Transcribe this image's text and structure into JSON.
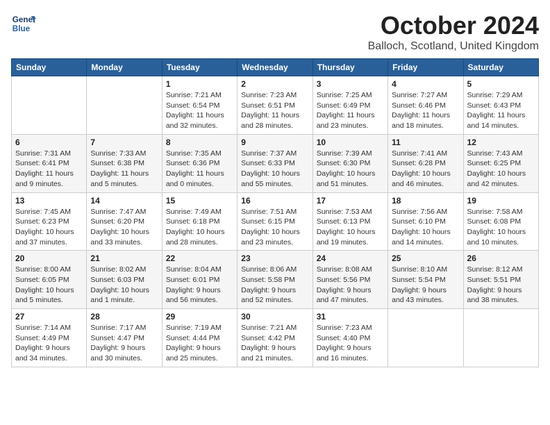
{
  "header": {
    "logo_line1": "General",
    "logo_line2": "Blue",
    "month_title": "October 2024",
    "location": "Balloch, Scotland, United Kingdom"
  },
  "days_of_week": [
    "Sunday",
    "Monday",
    "Tuesday",
    "Wednesday",
    "Thursday",
    "Friday",
    "Saturday"
  ],
  "weeks": [
    [
      {
        "day": "",
        "sunrise": "",
        "sunset": "",
        "daylight": ""
      },
      {
        "day": "",
        "sunrise": "",
        "sunset": "",
        "daylight": ""
      },
      {
        "day": "1",
        "sunrise": "Sunrise: 7:21 AM",
        "sunset": "Sunset: 6:54 PM",
        "daylight": "Daylight: 11 hours and 32 minutes."
      },
      {
        "day": "2",
        "sunrise": "Sunrise: 7:23 AM",
        "sunset": "Sunset: 6:51 PM",
        "daylight": "Daylight: 11 hours and 28 minutes."
      },
      {
        "day": "3",
        "sunrise": "Sunrise: 7:25 AM",
        "sunset": "Sunset: 6:49 PM",
        "daylight": "Daylight: 11 hours and 23 minutes."
      },
      {
        "day": "4",
        "sunrise": "Sunrise: 7:27 AM",
        "sunset": "Sunset: 6:46 PM",
        "daylight": "Daylight: 11 hours and 18 minutes."
      },
      {
        "day": "5",
        "sunrise": "Sunrise: 7:29 AM",
        "sunset": "Sunset: 6:43 PM",
        "daylight": "Daylight: 11 hours and 14 minutes."
      }
    ],
    [
      {
        "day": "6",
        "sunrise": "Sunrise: 7:31 AM",
        "sunset": "Sunset: 6:41 PM",
        "daylight": "Daylight: 11 hours and 9 minutes."
      },
      {
        "day": "7",
        "sunrise": "Sunrise: 7:33 AM",
        "sunset": "Sunset: 6:38 PM",
        "daylight": "Daylight: 11 hours and 5 minutes."
      },
      {
        "day": "8",
        "sunrise": "Sunrise: 7:35 AM",
        "sunset": "Sunset: 6:36 PM",
        "daylight": "Daylight: 11 hours and 0 minutes."
      },
      {
        "day": "9",
        "sunrise": "Sunrise: 7:37 AM",
        "sunset": "Sunset: 6:33 PM",
        "daylight": "Daylight: 10 hours and 55 minutes."
      },
      {
        "day": "10",
        "sunrise": "Sunrise: 7:39 AM",
        "sunset": "Sunset: 6:30 PM",
        "daylight": "Daylight: 10 hours and 51 minutes."
      },
      {
        "day": "11",
        "sunrise": "Sunrise: 7:41 AM",
        "sunset": "Sunset: 6:28 PM",
        "daylight": "Daylight: 10 hours and 46 minutes."
      },
      {
        "day": "12",
        "sunrise": "Sunrise: 7:43 AM",
        "sunset": "Sunset: 6:25 PM",
        "daylight": "Daylight: 10 hours and 42 minutes."
      }
    ],
    [
      {
        "day": "13",
        "sunrise": "Sunrise: 7:45 AM",
        "sunset": "Sunset: 6:23 PM",
        "daylight": "Daylight: 10 hours and 37 minutes."
      },
      {
        "day": "14",
        "sunrise": "Sunrise: 7:47 AM",
        "sunset": "Sunset: 6:20 PM",
        "daylight": "Daylight: 10 hours and 33 minutes."
      },
      {
        "day": "15",
        "sunrise": "Sunrise: 7:49 AM",
        "sunset": "Sunset: 6:18 PM",
        "daylight": "Daylight: 10 hours and 28 minutes."
      },
      {
        "day": "16",
        "sunrise": "Sunrise: 7:51 AM",
        "sunset": "Sunset: 6:15 PM",
        "daylight": "Daylight: 10 hours and 23 minutes."
      },
      {
        "day": "17",
        "sunrise": "Sunrise: 7:53 AM",
        "sunset": "Sunset: 6:13 PM",
        "daylight": "Daylight: 10 hours and 19 minutes."
      },
      {
        "day": "18",
        "sunrise": "Sunrise: 7:56 AM",
        "sunset": "Sunset: 6:10 PM",
        "daylight": "Daylight: 10 hours and 14 minutes."
      },
      {
        "day": "19",
        "sunrise": "Sunrise: 7:58 AM",
        "sunset": "Sunset: 6:08 PM",
        "daylight": "Daylight: 10 hours and 10 minutes."
      }
    ],
    [
      {
        "day": "20",
        "sunrise": "Sunrise: 8:00 AM",
        "sunset": "Sunset: 6:05 PM",
        "daylight": "Daylight: 10 hours and 5 minutes."
      },
      {
        "day": "21",
        "sunrise": "Sunrise: 8:02 AM",
        "sunset": "Sunset: 6:03 PM",
        "daylight": "Daylight: 10 hours and 1 minute."
      },
      {
        "day": "22",
        "sunrise": "Sunrise: 8:04 AM",
        "sunset": "Sunset: 6:01 PM",
        "daylight": "Daylight: 9 hours and 56 minutes."
      },
      {
        "day": "23",
        "sunrise": "Sunrise: 8:06 AM",
        "sunset": "Sunset: 5:58 PM",
        "daylight": "Daylight: 9 hours and 52 minutes."
      },
      {
        "day": "24",
        "sunrise": "Sunrise: 8:08 AM",
        "sunset": "Sunset: 5:56 PM",
        "daylight": "Daylight: 9 hours and 47 minutes."
      },
      {
        "day": "25",
        "sunrise": "Sunrise: 8:10 AM",
        "sunset": "Sunset: 5:54 PM",
        "daylight": "Daylight: 9 hours and 43 minutes."
      },
      {
        "day": "26",
        "sunrise": "Sunrise: 8:12 AM",
        "sunset": "Sunset: 5:51 PM",
        "daylight": "Daylight: 9 hours and 38 minutes."
      }
    ],
    [
      {
        "day": "27",
        "sunrise": "Sunrise: 7:14 AM",
        "sunset": "Sunset: 4:49 PM",
        "daylight": "Daylight: 9 hours and 34 minutes."
      },
      {
        "day": "28",
        "sunrise": "Sunrise: 7:17 AM",
        "sunset": "Sunset: 4:47 PM",
        "daylight": "Daylight: 9 hours and 30 minutes."
      },
      {
        "day": "29",
        "sunrise": "Sunrise: 7:19 AM",
        "sunset": "Sunset: 4:44 PM",
        "daylight": "Daylight: 9 hours and 25 minutes."
      },
      {
        "day": "30",
        "sunrise": "Sunrise: 7:21 AM",
        "sunset": "Sunset: 4:42 PM",
        "daylight": "Daylight: 9 hours and 21 minutes."
      },
      {
        "day": "31",
        "sunrise": "Sunrise: 7:23 AM",
        "sunset": "Sunset: 4:40 PM",
        "daylight": "Daylight: 9 hours and 16 minutes."
      },
      {
        "day": "",
        "sunrise": "",
        "sunset": "",
        "daylight": ""
      },
      {
        "day": "",
        "sunrise": "",
        "sunset": "",
        "daylight": ""
      }
    ]
  ]
}
